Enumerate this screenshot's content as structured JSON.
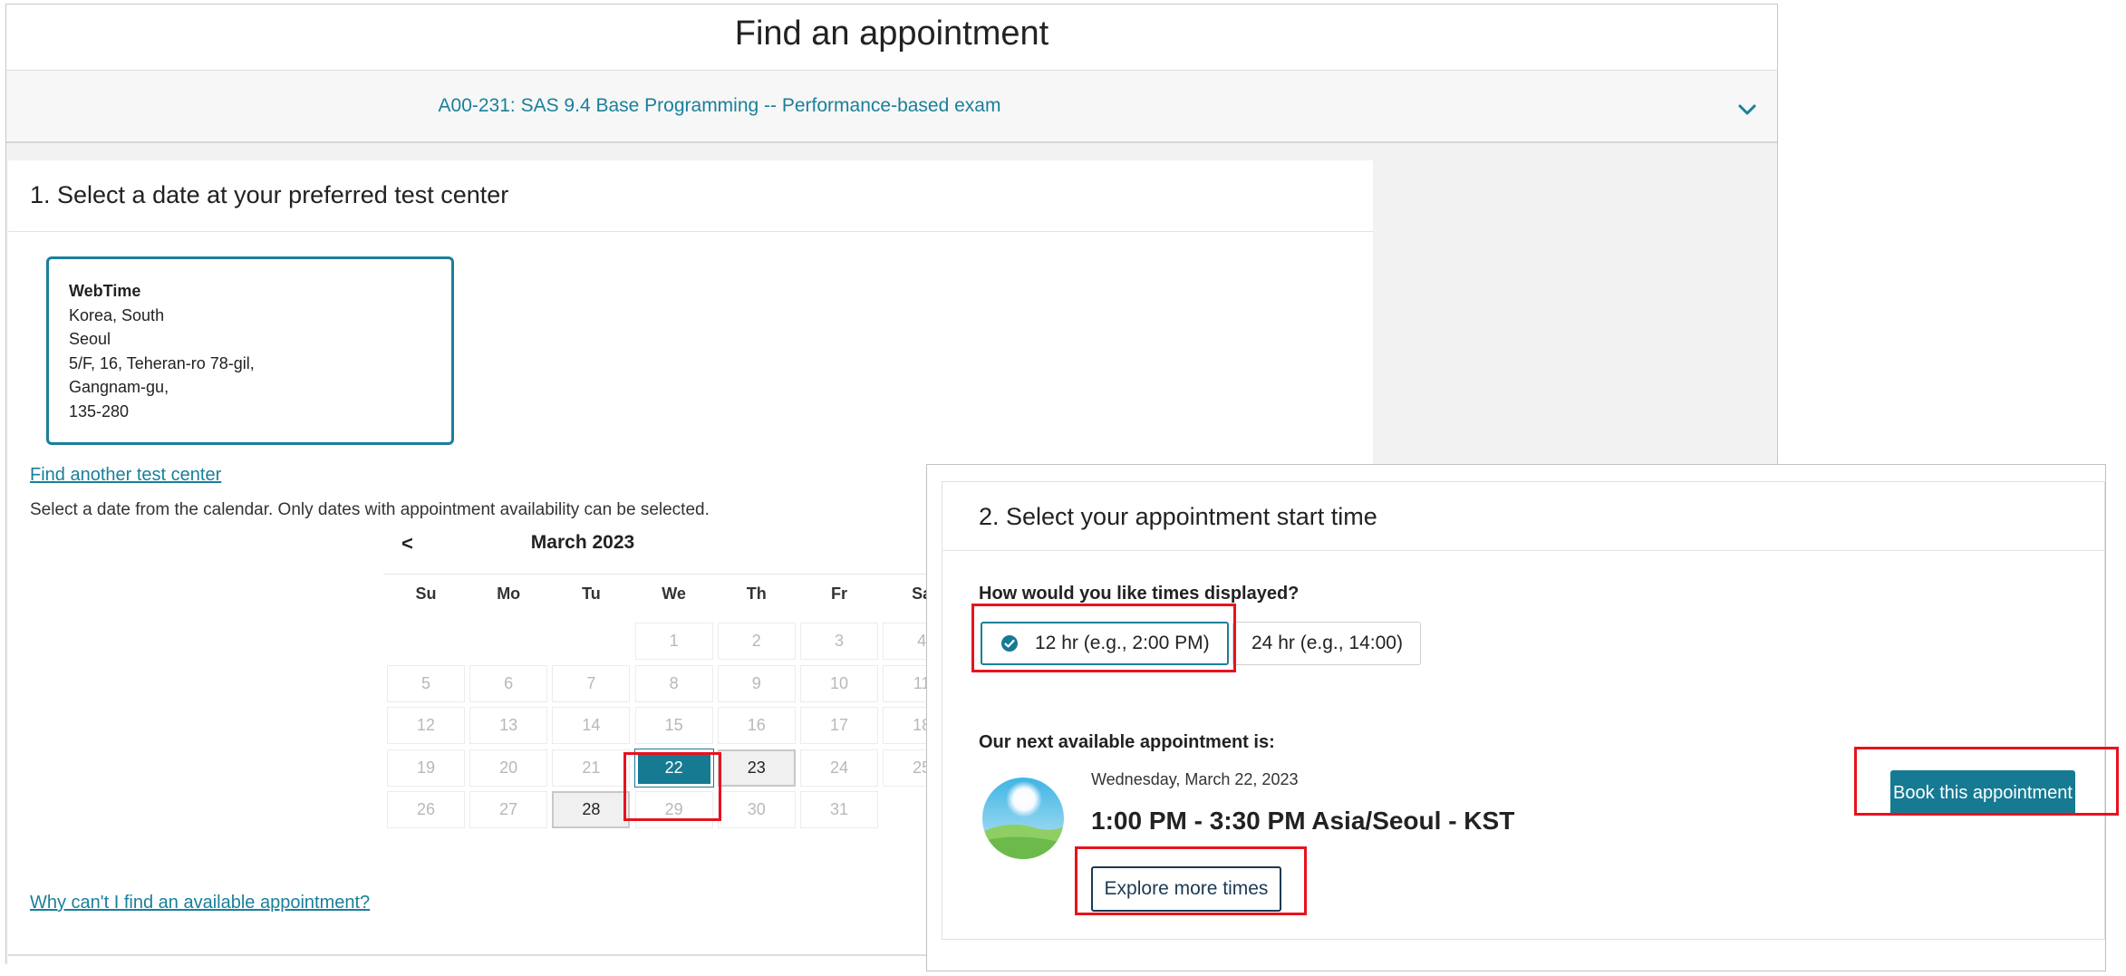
{
  "page": {
    "title": "Find an appointment",
    "exam": "A00-231: SAS 9.4 Base Programming -- Performance-based exam"
  },
  "section1": {
    "heading": "1. Select a date at your preferred test center",
    "center": {
      "name": "WebTime",
      "lines": [
        "Korea, South",
        "Seoul",
        "5/F, 16, Teheran-ro 78-gil,",
        "Gangnam-gu,",
        "135-280"
      ]
    },
    "find_another_link": "Find another test center",
    "calendar_hint": "Select a date from the calendar. Only dates with appointment availability can be selected.",
    "calendar": {
      "prev": "<",
      "month": "March 2023",
      "weekdays": [
        "Su",
        "Mo",
        "Tu",
        "We",
        "Th",
        "Fr",
        "Sa"
      ],
      "first_weekday_index": 3,
      "days_in_month": 31,
      "available": [
        22,
        23,
        28
      ],
      "selected": 22
    },
    "why_link": "Why can't I find an available appointment?"
  },
  "section2": {
    "heading": "2. Select your appointment start time",
    "format_question": "How would you like times displayed?",
    "format_12": "12 hr (e.g., 2:00 PM)",
    "format_24": "24 hr (e.g., 14:00)",
    "selected_format": "12",
    "next_label": "Our next available appointment is:",
    "slot_date": "Wednesday, March 22, 2023",
    "slot_time": "1:00 PM - 3:30 PM Asia/Seoul - KST",
    "explore_button": "Explore more times",
    "book_button": "Book this appointment"
  },
  "colors": {
    "accent": "#167a93",
    "highlight": "#e8121e"
  }
}
